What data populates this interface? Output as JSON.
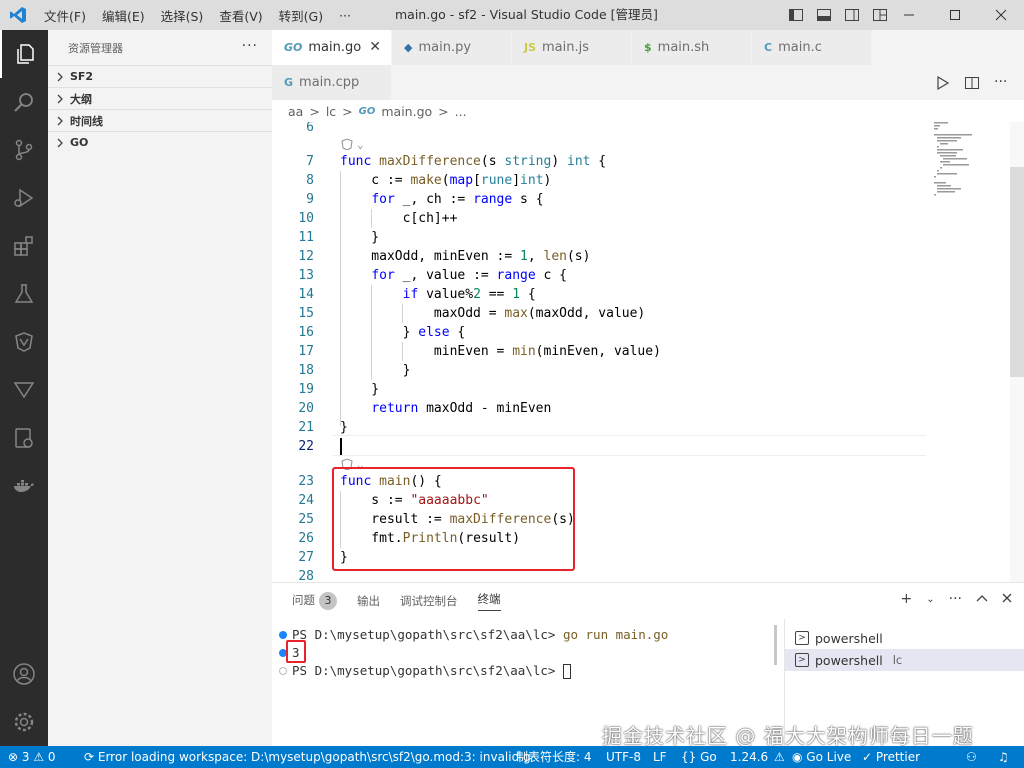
{
  "app": {
    "title": "main.go - sf2 - Visual Studio Code [管理员]",
    "menu": [
      "文件(F)",
      "编辑(E)",
      "选择(S)",
      "查看(V)",
      "转到(G)",
      "···"
    ]
  },
  "sidebar": {
    "title": "资源管理器",
    "more": "···",
    "sections": [
      "SF2",
      "大纲",
      "时间线",
      "GO"
    ]
  },
  "tabs": [
    {
      "label": "main.go",
      "icon": "GO",
      "active": true
    },
    {
      "label": "main.py",
      "icon": "◆"
    },
    {
      "label": "main.js",
      "icon": "JS"
    },
    {
      "label": "main.sh",
      "icon": "$"
    },
    {
      "label": "main.c",
      "icon": "C"
    },
    {
      "label": "main.cpp",
      "icon": "G"
    }
  ],
  "breadcrumb": [
    "aa",
    ">",
    "lc",
    ">",
    "main.go",
    ">",
    "..."
  ],
  "editor": {
    "current_line": 22,
    "line_numbers": [
      "6",
      "7",
      "8",
      "9",
      "10",
      "11",
      "12",
      "13",
      "14",
      "15",
      "16",
      "17",
      "18",
      "19",
      "20",
      "21",
      "22",
      "23",
      "24",
      "25",
      "26",
      "27",
      "28"
    ]
  },
  "panel": {
    "tabs": [
      "问题",
      "输出",
      "调试控制台",
      "终端"
    ],
    "problems_count": "3",
    "terminal": {
      "prompt1": "PS D:\\mysetup\\gopath\\src\\sf2\\aa\\lc> ",
      "command": "go run main.go",
      "output": "3",
      "prompt2": "PS D:\\mysetup\\gopath\\src\\sf2\\aa\\lc> "
    },
    "terminal_list": [
      {
        "label": "powershell",
        "tag": ""
      },
      {
        "label": "powershell",
        "tag": "lc"
      }
    ]
  },
  "watermark": "掘金技术社区 @ 福大大架构师每日一题",
  "statusbar": {
    "problems": "⊗ 3 ⚠ 0",
    "error": "Error loading workspace: D:\\mysetup\\gopath\\src\\sf2\\go.mod:3: invalid g",
    "tab_size": "制表符长度: 4",
    "encoding": "UTF-8",
    "eol": "LF",
    "language": "{} Go",
    "go_version": "1.24.6",
    "golive": "Go Live",
    "prettier": "Prettier"
  },
  "colors": {
    "accent": "#007acc",
    "highlight": "#e8242a",
    "keyword": "#0000ff",
    "string": "#a31515",
    "number": "#098658"
  }
}
